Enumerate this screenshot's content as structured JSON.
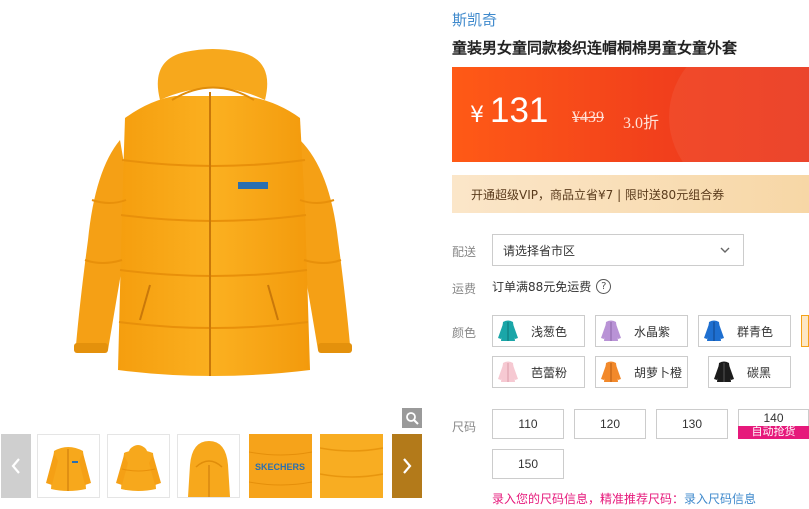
{
  "product": {
    "brand": "斯凯奇",
    "title": "童装男女童同款梭织连帽桐棉男童女童外套"
  },
  "price": {
    "currency": "¥",
    "current": "131",
    "original": "¥439",
    "discount": "3.0折"
  },
  "vip": {
    "text": "开通超级VIP，商品立省¥7 | 限时送80元组合券"
  },
  "delivery": {
    "label": "配送",
    "select_value": "请选择省市区"
  },
  "shipping": {
    "label": "运费",
    "text": "订单满88元免运费",
    "help_icon": "?"
  },
  "colors": {
    "label": "颜色",
    "options": [
      {
        "name": "浅葱色",
        "swatch": "#1aa6a8",
        "icon": "jacket-icon"
      },
      {
        "name": "水晶紫",
        "swatch": "#b993d6",
        "icon": "jacket-icon"
      },
      {
        "name": "群青色",
        "swatch": "#1e6fd0",
        "icon": "jacket-icon"
      },
      {
        "name": "芭蕾粉",
        "swatch": "#f6c9d2",
        "icon": "jacket-icon"
      },
      {
        "name": "胡萝卜橙",
        "swatch": "#f2892b",
        "icon": "jacket-icon"
      },
      {
        "name": "碳黑",
        "swatch": "#1c1c1c",
        "icon": "jacket-icon"
      }
    ],
    "partial_swatch": "#f4a21a"
  },
  "sizes": {
    "label": "尺码",
    "options": [
      "110",
      "120",
      "130",
      "140",
      "150"
    ],
    "auto_badge": "自动抢货"
  },
  "size_info": {
    "prefix": "录入您的尺码信息，精准推荐尺码：",
    "link": "录入尺码信息"
  },
  "gallery": {
    "jacket_color": "#f7a81c",
    "logo_text": "SKECHERS",
    "thumbnails": [
      "front-view",
      "back-view",
      "hood-view",
      "logo-closeup",
      "fabric-closeup",
      "fabric-partial"
    ]
  }
}
